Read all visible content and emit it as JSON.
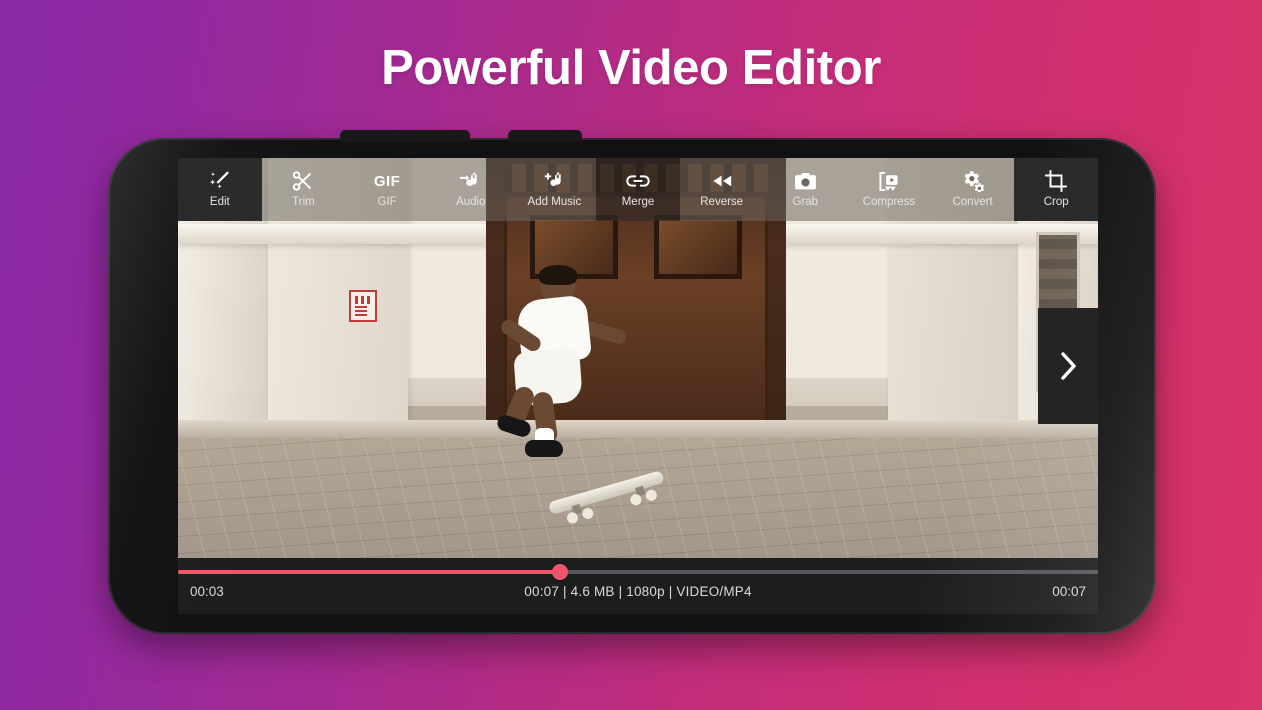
{
  "headline": "Powerful Video Editor",
  "colors": {
    "gradient_start": "#8a2ba8",
    "gradient_end": "#d8336a",
    "accent_progress": "#f2556a",
    "screen_bg": "#1d1d1f",
    "toolbar_overlay": "rgba(110,104,94,0.55)"
  },
  "toolbar": {
    "items": [
      {
        "label": "Edit",
        "icon": "magic-wand-icon",
        "state": "opaque"
      },
      {
        "label": "Trim",
        "icon": "scissors-icon",
        "state": "overlay"
      },
      {
        "label": "GIF",
        "icon": "gif-text-icon",
        "state": "overlay"
      },
      {
        "label": "Audio",
        "icon": "audio-extract-icon",
        "state": "overlay"
      },
      {
        "label": "Add Music",
        "icon": "add-music-icon",
        "state": "overlay"
      },
      {
        "label": "Merge",
        "icon": "link-icon",
        "state": "dim"
      },
      {
        "label": "Reverse",
        "icon": "rewind-icon",
        "state": "overlay"
      },
      {
        "label": "Grab",
        "icon": "camera-icon",
        "state": "overlay"
      },
      {
        "label": "Compress",
        "icon": "compress-icon",
        "state": "overlay"
      },
      {
        "label": "Convert",
        "icon": "gears-icon",
        "state": "overlay"
      },
      {
        "label": "Crop",
        "icon": "crop-icon",
        "state": "opaque"
      }
    ]
  },
  "player": {
    "next_icon": "chevron-right-icon",
    "current_time": "00:03",
    "total_time": "00:07",
    "info": "00:07 | 4.6 MB | 1080p | VIDEO/MP4",
    "progress_percent": 41.5
  },
  "video": {
    "description": "skateboarder-mid-trick-outside-building"
  }
}
